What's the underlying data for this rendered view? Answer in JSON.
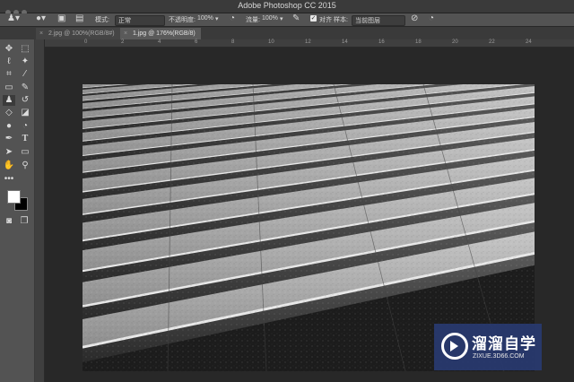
{
  "app": {
    "title": "Adobe Photoshop CC 2015"
  },
  "options_bar": {
    "mode_label": "模式:",
    "mode_value": "正常",
    "opacity_label": "不透明度:",
    "opacity_value": "100%",
    "flow_label": "流量:",
    "flow_value": "100%",
    "align_label": "对齐",
    "sample_label": "样本:",
    "sample_value": "当前图层"
  },
  "tabs": [
    {
      "label": "2.jpg @ 100%(RGB/8#)"
    },
    {
      "label": "1.jpg @ 176%(RGB/8)"
    }
  ],
  "ruler": {
    "ticks": [
      "0",
      "2",
      "4",
      "6",
      "8",
      "10",
      "12",
      "14",
      "16",
      "18",
      "20",
      "22",
      "24"
    ]
  },
  "colors": {
    "foreground": "#ffffff",
    "background": "#000000"
  },
  "watermark": {
    "main": "溜溜自学",
    "sub": "ZIXUE.3D66.COM"
  },
  "tools": [
    "move-icon",
    "marquee-icon",
    "lasso-icon",
    "magic-wand-icon",
    "crop-icon",
    "eyedropper-icon",
    "healing-brush-icon",
    "brush-icon",
    "clone-stamp-icon",
    "history-brush-icon",
    "eraser-icon",
    "paint-bucket-icon",
    "blur-icon",
    "dodge-icon",
    "pen-icon",
    "type-icon",
    "path-selection-icon",
    "rectangle-icon",
    "hand-icon",
    "zoom-icon"
  ]
}
